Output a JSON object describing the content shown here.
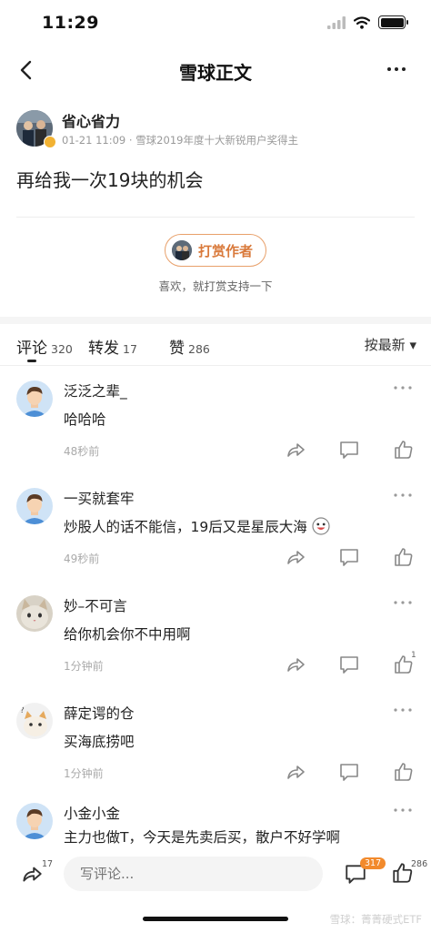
{
  "status_bar": {
    "time": "11:29"
  },
  "nav": {
    "title": "雪球正文"
  },
  "post": {
    "author": "省心省力",
    "meta": "01-21 11:09 · 雪球2019年度十大新锐用户奖得主",
    "body": "再给我一次19块的机会",
    "reward_button": "打赏作者",
    "reward_hint": "喜欢，就打赏支持一下"
  },
  "tabs": [
    {
      "label": "评论",
      "count": "320"
    },
    {
      "label": "转发",
      "count": "17"
    },
    {
      "label": "赞",
      "count": "286"
    }
  ],
  "sort": {
    "label": "按最新 ▾"
  },
  "comments": [
    {
      "name": "泛泛之辈_",
      "text": "哈哈哈",
      "time": "48秒前",
      "like_count": ""
    },
    {
      "name": "一买就套牢",
      "text": "炒股人的话不能信，19后又是星辰大海",
      "time": "49秒前",
      "like_count": ""
    },
    {
      "name": "妙–不可言",
      "text": "给你机会你不中用啊",
      "time": "1分钟前",
      "like_count": "1"
    },
    {
      "name": "薛定谔的仓",
      "text": "买海底捞吧",
      "time": "1分钟前",
      "like_count": ""
    },
    {
      "name": "小金小金",
      "text": "主力也做T，今天是先卖后买，散户不好学啊",
      "time": "",
      "like_count": ""
    }
  ],
  "bottom_bar": {
    "repost_count": "17",
    "input_placeholder": "写评论...",
    "comment_badge": "317",
    "like_count": "286"
  },
  "watermark": "雪球：菁菁硬式ETF",
  "colors": {
    "accent_orange": "#f28a2c",
    "reward_border": "#e8a06a",
    "text_main": "#222222",
    "text_muted": "#999999"
  }
}
